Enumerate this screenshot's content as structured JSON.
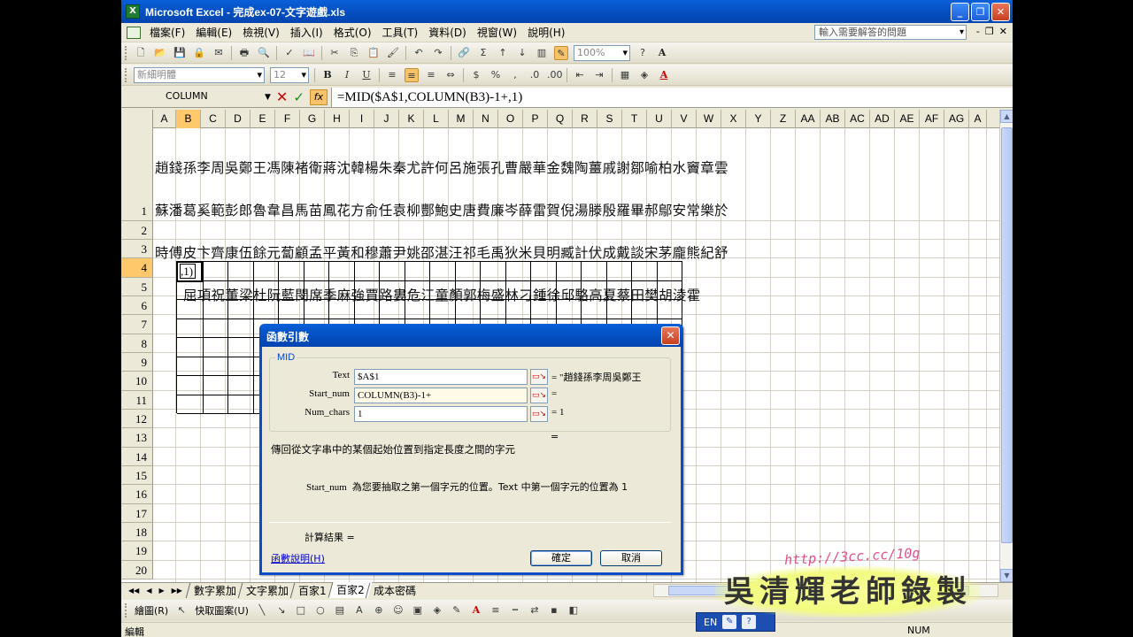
{
  "window": {
    "title": "Microsoft Excel - 完成ex-07-文字遊戲.xls",
    "app_icon": "X",
    "buttons": {
      "minimize": "_",
      "restore": "❐",
      "close": "✕"
    }
  },
  "menu": {
    "items": [
      "檔案(F)",
      "編輯(E)",
      "檢視(V)",
      "插入(I)",
      "格式(O)",
      "工具(T)",
      "資料(D)",
      "視窗(W)",
      "說明(H)"
    ],
    "help_placeholder": "輸入需要解答的問題",
    "mdi": {
      "minimize": "-",
      "restore": "❐",
      "close": "✕"
    }
  },
  "toolbar": {
    "font_name": "新細明體",
    "font_size": "12",
    "zoom": "100%",
    "bold": "B",
    "italic": "I",
    "underline": "U",
    "currency": "$",
    "percent": "%",
    "autosum": "Σ",
    "font_color": "A",
    "help": "?"
  },
  "formula_bar": {
    "name_box": "COLUMN",
    "cancel": "✕",
    "enter": "✓",
    "fx": "fx",
    "formula": "=MID($A$1,COLUMN(B3)-1+,1)"
  },
  "grid": {
    "columns": [
      "A",
      "B",
      "C",
      "D",
      "E",
      "F",
      "G",
      "H",
      "I",
      "J",
      "K",
      "L",
      "M",
      "N",
      "O",
      "P",
      "Q",
      "R",
      "S",
      "T",
      "U",
      "V",
      "W",
      "X",
      "Y",
      "Z",
      "AA",
      "AB",
      "AC",
      "AD",
      "AE",
      "AF",
      "AG",
      "A"
    ],
    "selected_column": "B",
    "rows": [
      "1",
      "2",
      "3",
      "4",
      "5",
      "6",
      "7",
      "8",
      "9",
      "10",
      "11",
      "12",
      "13",
      "14",
      "15",
      "16",
      "17",
      "18",
      "19",
      "20"
    ],
    "selected_row": "4",
    "a1_lines": [
      "趙錢孫李周吳鄭王馮陳褚衛蔣沈韓楊朱秦尤許何呂施張孔曹嚴華金魏陶薑戚謝鄒喻柏水竇章雲",
      "蘇潘葛奚範彭郎魯韋昌馬苗鳳花方俞任袁柳酆鮑史唐費廉岑薛雷賀倪湯滕殷羅畢郝鄔安常樂於",
      "時傅皮卞齊康伍餘元蔔顧孟平黃和穆蕭尹姚邵湛汪祁毛禹狄米貝明臧計伏成戴談宋茅龐熊紀舒",
      "屈項祝董梁杜阮藍閔席季麻強賈路婁危江童顏郭梅盛林刁鍾徐邱駱高夏蔡田樊胡淩霍"
    ],
    "active_cell_text": ",1)"
  },
  "dialog": {
    "title": "函數引數",
    "function_name": "MID",
    "args": [
      {
        "label": "Text",
        "value": "$A$1",
        "result": "= \"趙錢孫李周吳鄭王"
      },
      {
        "label": "Start_num",
        "value": "COLUMN(B3)-1+",
        "result": "="
      },
      {
        "label": "Num_chars",
        "value": "1",
        "result": "= 1"
      }
    ],
    "result_eq": "=",
    "description": "傳回從文字串中的某個起始位置到指定長度之間的字元",
    "arg_help_name": "Start_num",
    "arg_help_text": "為您要抽取之第一個字元的位置。Text 中第一個字元的位置為 1",
    "calc_result": "計算結果 =",
    "help_link": "函數說明(H)",
    "ok": "確定",
    "cancel": "取消",
    "close": "✕"
  },
  "sheet_tabs": {
    "nav": [
      "◀◀",
      "◀",
      "▶",
      "▶▶"
    ],
    "tabs": [
      "數字累加",
      "文字累加",
      "百家1",
      "百家2",
      "成本密碼"
    ],
    "active": "百家2"
  },
  "drawing_toolbar": {
    "draw": "繪圖(R)",
    "autoshapes": "快取圖案(U)"
  },
  "status": {
    "mode": "編輯",
    "num": "NUM"
  },
  "language_bar": {
    "lang": "EN",
    "help": "?"
  },
  "watermark": {
    "url": "http://3cc.cc/10g",
    "name": "吳清輝老師錄製"
  }
}
